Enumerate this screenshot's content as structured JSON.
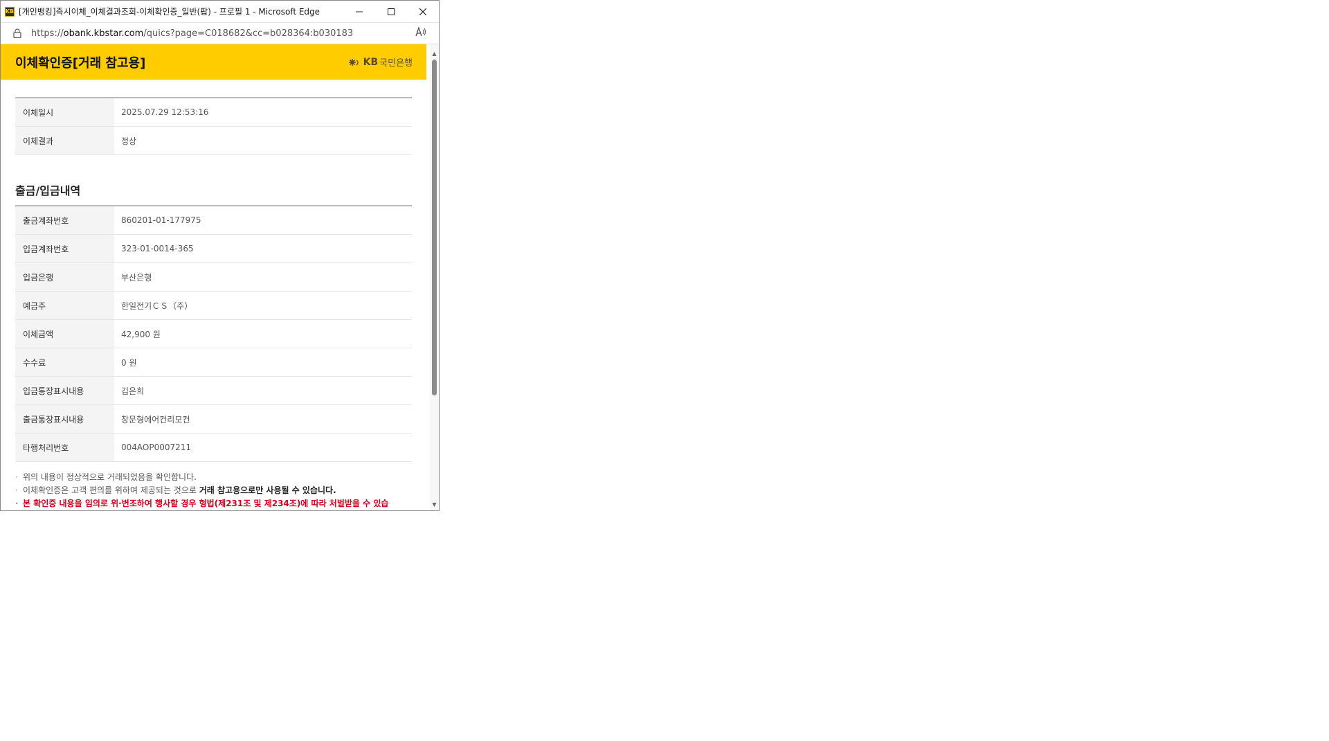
{
  "window": {
    "title": "[개인뱅킹]즉시이체_이체결과조회-이체확인증_일반(팝) - 프로필 1 - Microsoft Edge",
    "url_scheme": "https://",
    "url_host": "obank.kbstar.com",
    "url_path": "/quics?page=C018682&cc=b028364:b030183",
    "read_aloud_label": "Á̤"
  },
  "header": {
    "title": "이체확인증[거래 참고용]",
    "logo_kb": "KB",
    "logo_bank": "국민은행",
    "bg_color": "#ffcc00"
  },
  "summary": {
    "rows": [
      {
        "label": "이체일시",
        "value": "2025.07.29 12:53:16"
      },
      {
        "label": "이체결과",
        "value": "정상"
      }
    ]
  },
  "details": {
    "title": "출금/입금내역",
    "rows": [
      {
        "label": "출금계좌번호",
        "value": "860201-01-177975"
      },
      {
        "label": "입금계좌번호",
        "value": "323-01-0014-365"
      },
      {
        "label": "입금은행",
        "value": "부산은행"
      },
      {
        "label": "예금주",
        "value": "한일전기ＣＳ（주）"
      },
      {
        "label": "이체금액",
        "value": "42,900 원"
      },
      {
        "label": "수수료",
        "value": "0 원"
      },
      {
        "label": "입금통장표시내용",
        "value": "김은희"
      },
      {
        "label": "출금통장표시내용",
        "value": "창문형에어컨리모컨"
      },
      {
        "label": "타행처리번호",
        "value": "004AOP0007211"
      }
    ]
  },
  "notes": {
    "line1": "위의 내용이 정상적으로 거래되었음을 확인합니다.",
    "line2_normal": "이체확인증은 고객 편의를 위하여 제공되는 것으로 ",
    "line2_bold": "거래 참고용으로만 사용될 수 있습니다.",
    "line3": "본 확인증 내용을 임의로 위·변조하여 행사할 경우 형법(제231조 및 제234조)에 따라 처벌받을 수 있습"
  }
}
